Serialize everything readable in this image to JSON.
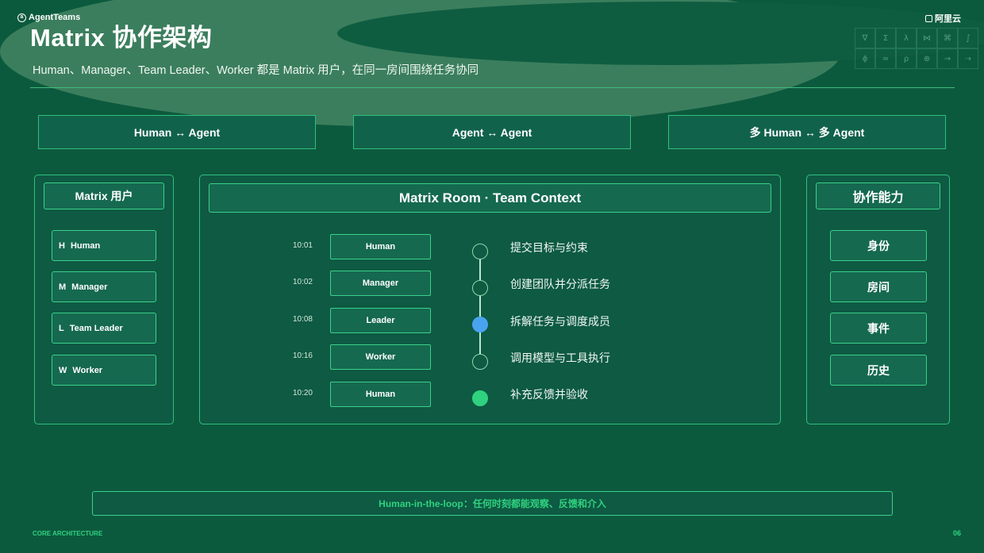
{
  "brand": {
    "logo_icon": "agentteams-logo-icon",
    "name": "AgentTeams"
  },
  "partner": {
    "logo_icon": "aliyun-logo-icon",
    "name": "阿里云"
  },
  "title": "Matrix 协作架构",
  "subtitle": "Human、Manager、Team Leader、Worker 都是 Matrix 用户，在同一房间围绕任务协同",
  "glyphs": [
    "∇",
    "Σ",
    "λ",
    "⋈",
    "⌘",
    "∫",
    "ϕ",
    "≈",
    "ρ",
    "⊕",
    "→",
    "⇢"
  ],
  "modes": [
    "Human ↔ Agent",
    "Agent ↔ Agent",
    "多 Human ↔ 多 Agent"
  ],
  "users_panel": {
    "title": "Matrix 用户",
    "items": [
      {
        "abbr": "H",
        "label": "Human"
      },
      {
        "abbr": "M",
        "label": "Manager"
      },
      {
        "abbr": "L",
        "label": "Team Leader"
      },
      {
        "abbr": "W",
        "label": "Worker"
      }
    ]
  },
  "room": {
    "title": "Matrix Room · Team Context",
    "timeline": [
      {
        "time": "10:01",
        "actor": "Human",
        "text": "提交目标与约束",
        "state": "pending"
      },
      {
        "time": "10:02",
        "actor": "Manager",
        "text": "创建团队并分派任务",
        "state": "pending"
      },
      {
        "time": "10:08",
        "actor": "Leader",
        "text": "拆解任务与调度成员",
        "state": "active"
      },
      {
        "time": "10:16",
        "actor": "Worker",
        "text": "调用模型与工具执行",
        "state": "pending"
      },
      {
        "time": "10:20",
        "actor": "Human",
        "text": "补充反馈并验收",
        "state": "done"
      }
    ]
  },
  "capabilities": {
    "title": "协作能力",
    "items": [
      "身份",
      "房间",
      "事件",
      "历史"
    ]
  },
  "hitl": "Human-in-the-loop：任何时刻都能观察、反馈和介入",
  "footer": {
    "section": "CORE ARCHITECTURE",
    "page": "06"
  },
  "colors": {
    "background": "#0c5a3e",
    "accent": "#2fd27f",
    "active_dot": "#4aa3ee"
  }
}
